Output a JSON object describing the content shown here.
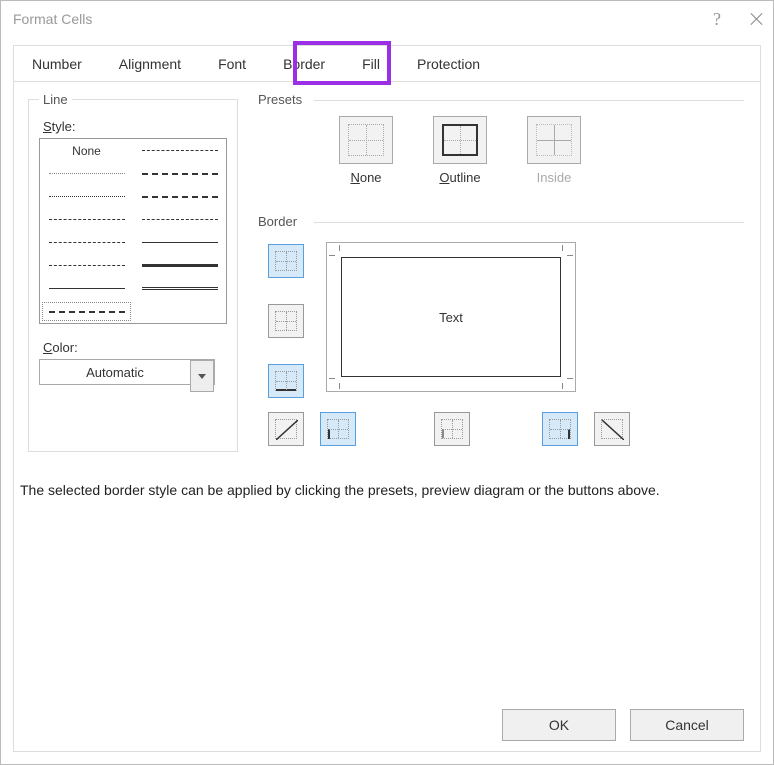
{
  "title": "Format Cells",
  "tabs": [
    "Number",
    "Alignment",
    "Font",
    "Border",
    "Fill",
    "Protection"
  ],
  "active_tab_index": 3,
  "line": {
    "group": "Line",
    "style_label": "Style:",
    "none_label": "None",
    "color_label": "Color:",
    "color_value": "Automatic"
  },
  "presets": {
    "group": "Presets",
    "none": "None",
    "outline": "Outline",
    "inside": "Inside"
  },
  "border": {
    "group": "Border",
    "preview_text": "Text"
  },
  "hint": "The selected border style can be applied by clicking the presets, preview diagram or the buttons above.",
  "buttons": {
    "ok": "OK",
    "cancel": "Cancel"
  }
}
